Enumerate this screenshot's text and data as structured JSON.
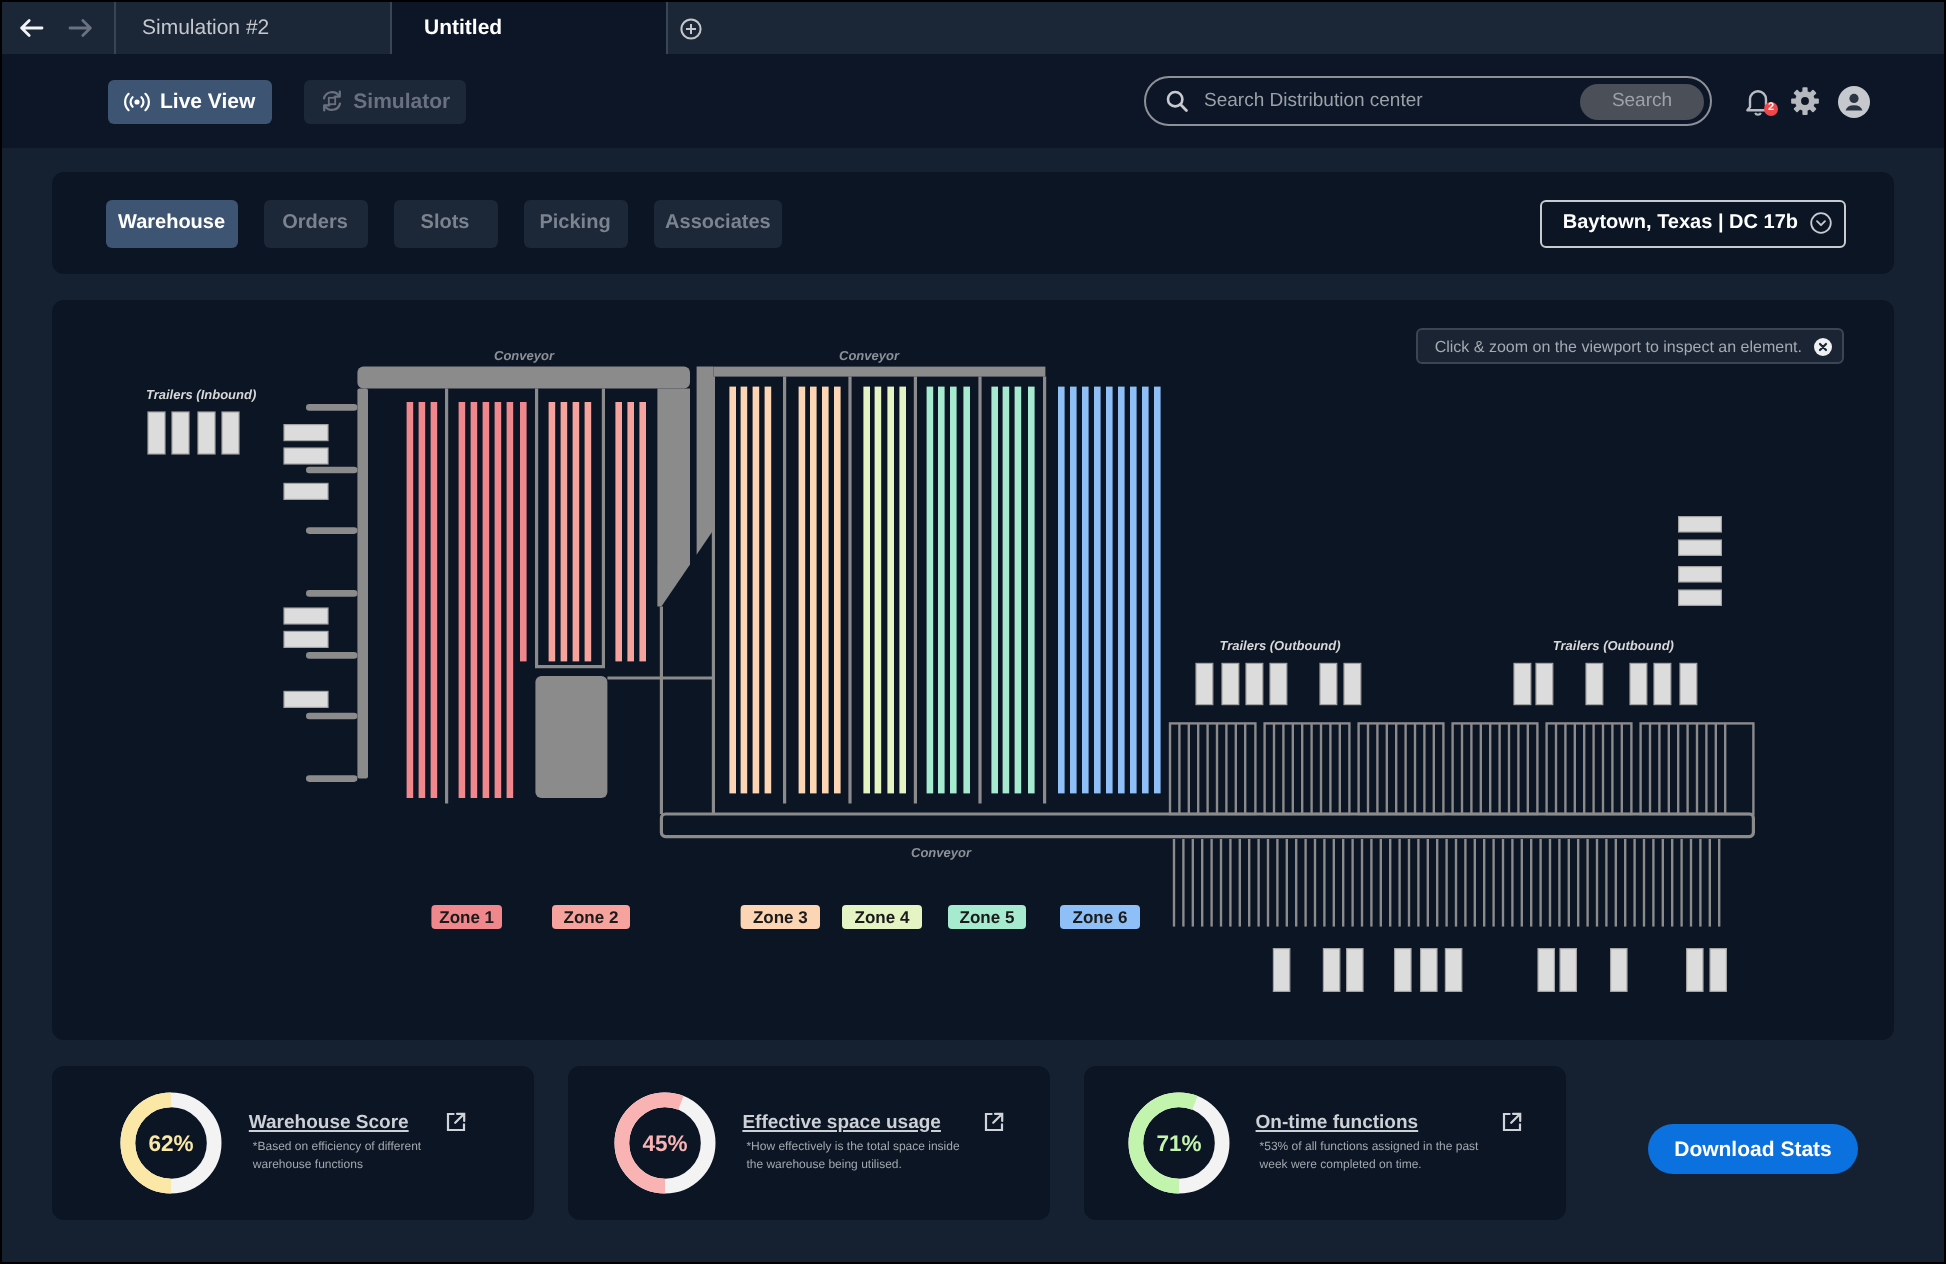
{
  "browser": {
    "nav": {
      "back": {
        "disabled": false
      },
      "forward": {
        "disabled": true
      }
    },
    "tabs": [
      {
        "label": "Simulation #2",
        "selected": false
      },
      {
        "label": "Untitled",
        "selected": true
      }
    ]
  },
  "header": {
    "modes": [
      {
        "kind": "live",
        "label": "Live View",
        "selected": true
      },
      {
        "kind": "simulator",
        "label": "Simulator",
        "selected": false
      }
    ],
    "search": {
      "placeholder": "Search Distribution center",
      "button": "Search"
    },
    "notifications": {
      "count": "2"
    }
  },
  "view_tabs": [
    {
      "label": "Warehouse",
      "selected": true
    },
    {
      "label": "Orders",
      "selected": false
    },
    {
      "label": "Slots",
      "selected": false
    },
    {
      "label": "Picking",
      "selected": false
    },
    {
      "label": "Associates",
      "selected": false
    }
  ],
  "location": "Baytown, Texas | DC 17b",
  "map": {
    "hint": "Click & zoom on the viewport to inspect an element.",
    "conveyor_labels": [
      "Conveyor",
      "Conveyor",
      "Conveyor"
    ],
    "inbound_trailers_label": "Trailers (Inbound)",
    "outbound_trailers_labels": [
      "Trailers (Outbound)",
      "Trailers (Outbound)"
    ],
    "zones": [
      {
        "label": "Zone 1",
        "color": "#f0878d"
      },
      {
        "label": "Zone 2",
        "color": "#f6a29d"
      },
      {
        "label": "Zone 3",
        "color": "#fcd6b4"
      },
      {
        "label": "Zone 4",
        "color": "#e5f4c3"
      },
      {
        "label": "Zone 5",
        "color": "#a6eacf"
      },
      {
        "label": "Zone 6",
        "color": "#8ebff7"
      }
    ]
  },
  "stats": [
    {
      "value": "62%",
      "level": 0.5,
      "color": "#fbe8a6",
      "title": "Warehouse Score",
      "note": "*Based on efficiency of different\nwarehouse functions"
    },
    {
      "value": "45%",
      "level": 0.56,
      "color": "#f9b3b3",
      "title": "Effective space usage",
      "note": "*How effectively is the total space inside\nthe warehouse being utilised."
    },
    {
      "value": "71%",
      "level": 0.56,
      "color": "#c3f4ae",
      "title": "On-time functions",
      "note": "*53% of all functions assigned in the past\nweek were completed on time."
    }
  ],
  "download_button": "Download Stats"
}
